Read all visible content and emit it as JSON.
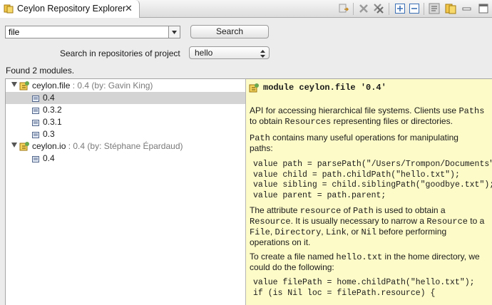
{
  "view": {
    "title": "Ceylon Repository Explorer",
    "close_glyph": "✕",
    "toolbar_icons": [
      "link-with-editor-icon",
      "remove-icon",
      "remove-all-icon",
      "expand-all-icon",
      "collapse-all-icon",
      "show-doc-icon",
      "repositories-icon",
      "menu-chevron-icon"
    ]
  },
  "search": {
    "value": "file",
    "button_label": "Search",
    "project_label": "Search in repositories of project",
    "project_value": "hello"
  },
  "status": "Found 2 modules.",
  "tree": {
    "modules": [
      {
        "name": "ceylon.file",
        "meta": " : 0.4 (by: Gavin King)",
        "versions": [
          "0.4",
          "0.3.2",
          "0.3.1",
          "0.3"
        ],
        "selected_version": "0.4"
      },
      {
        "name": "ceylon.io",
        "meta": " : 0.4 (by: Stéphane Épardaud)",
        "versions": [
          "0.4"
        ]
      }
    ]
  },
  "doc": {
    "title": "module ceylon.file '0.4'",
    "p1": {
      "a": "API for accessing hierarchical file systems. Clients use ",
      "b": "Paths",
      "c": "to obtain ",
      "d": "Resources",
      "e": " representing files or directories."
    },
    "p2": {
      "a": "Path",
      "b": " contains many useful operations for manipulating",
      "c": "paths:"
    },
    "code1": [
      "value path = parsePath(\"/Users/Trompon/Documents\");",
      "value child = path.childPath(\"hello.txt\");",
      "value sibling = child.siblingPath(\"goodbye.txt\");",
      "value parent = path.parent;"
    ],
    "p3": {
      "a": "The attribute ",
      "b": "resource",
      "c": " of ",
      "d": "Path",
      "e": " is used to obtain a",
      "f": "Resource",
      "g": ". It is usually necessary to narrow a ",
      "h": "Resource",
      "i": " to a",
      "j": "File",
      "k": ", ",
      "l": "Directory",
      "m": ", ",
      "n": "Link",
      "o": ", or ",
      "p": "Nil",
      "q": " before performing",
      "r": "operations on it."
    },
    "p4": {
      "a": "To create a file named ",
      "b": "hello.txt",
      "c": " in the home directory, we",
      "d": "could do the following:"
    },
    "code2": [
      "value filePath = home.childPath(\"hello.txt\");",
      "if (is Nil loc = filePath.resource) {"
    ]
  }
}
